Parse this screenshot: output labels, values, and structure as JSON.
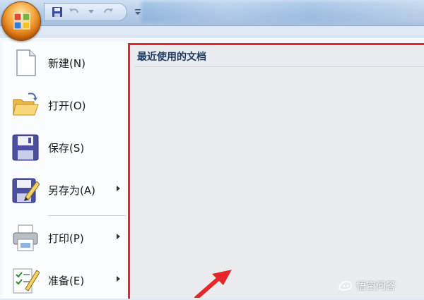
{
  "menu": {
    "items": [
      {
        "label": "新建(N)",
        "icon": "new-document-icon",
        "has_submenu": false
      },
      {
        "label": "打开(O)",
        "icon": "open-folder-icon",
        "has_submenu": false
      },
      {
        "label": "保存(S)",
        "icon": "save-disk-icon",
        "has_submenu": false
      },
      {
        "label": "另存为(A)",
        "icon": "save-as-icon",
        "has_submenu": true
      },
      {
        "label": "打印(P)",
        "icon": "printer-icon",
        "has_submenu": true
      },
      {
        "label": "准备(E)",
        "icon": "prepare-checklist-icon",
        "has_submenu": true
      }
    ]
  },
  "recent": {
    "title": "最近使用的文档"
  },
  "watermark": {
    "text": "悟空问答"
  },
  "colors": {
    "highlight_border": "#e5272b",
    "recent_title": "#1e3b63"
  }
}
